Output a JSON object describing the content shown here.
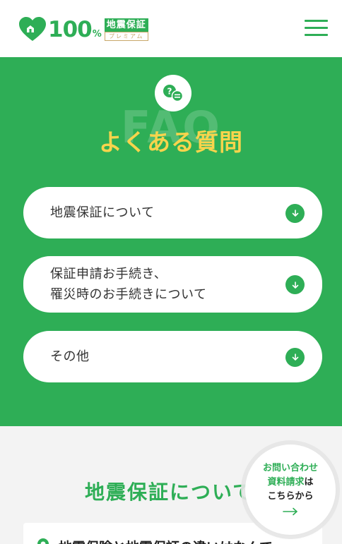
{
  "brand": {
    "number": "100",
    "percent": "%",
    "tag_top": "地震保証",
    "tag_bottom": "プレミアム",
    "color": "#2eae56",
    "gold": "#c9a86a"
  },
  "header": {
    "menu_icon": "hamburger-icon"
  },
  "faq": {
    "watermark": "FAQ",
    "title": "よくある質問",
    "badge_icon": "question-chat-icon",
    "items": [
      {
        "label": "地震保証について",
        "icon": "arrow-down-icon"
      },
      {
        "label": "保証申請お手続き、\n罹災時のお手続きについて",
        "icon": "arrow-down-icon"
      },
      {
        "label": "その他",
        "icon": "arrow-down-icon"
      }
    ],
    "bg_color": "#2eae56",
    "title_color": "#f8d44c"
  },
  "section": {
    "title": "地震保証について",
    "first_question": "地震保険と地震保証の違いはなんで"
  },
  "cta": {
    "line1": "お問い合わせ",
    "line2_highlight": "資料請求",
    "line2_rest": "は",
    "line3": "こちらから",
    "arrow_icon": "arrow-right-icon"
  }
}
